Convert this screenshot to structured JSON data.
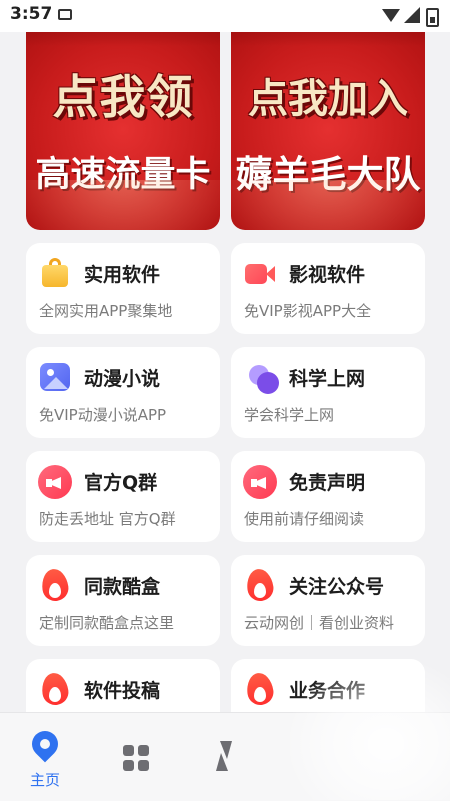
{
  "status_bar": {
    "time": "3:57"
  },
  "banners": [
    {
      "line1": "点我领",
      "line2": "高速流量卡"
    },
    {
      "line1": "点我加入",
      "line2": "薅羊毛大队"
    }
  ],
  "cards": [
    {
      "title": "实用软件",
      "subtitle": "全网实用APP聚集地",
      "icon": "shopping-bag-icon"
    },
    {
      "title": "影视软件",
      "subtitle": "免VIP影视APP大全",
      "icon": "video-camera-icon"
    },
    {
      "title": "动漫小说",
      "subtitle": "免VIP动漫小说APP",
      "icon": "picture-icon"
    },
    {
      "title": "科学上网",
      "subtitle": "学会科学上网",
      "icon": "bubbles-icon"
    },
    {
      "title": "官方Q群",
      "subtitle": "防走丢地址 官方Q群",
      "icon": "megaphone-icon"
    },
    {
      "title": "免责声明",
      "subtitle": "使用前请仔细阅读",
      "icon": "megaphone-icon"
    },
    {
      "title": "同款酷盒",
      "subtitle": "定制同款酷盒点这里",
      "icon": "flame-icon"
    },
    {
      "title": "关注公众号",
      "subtitle": "云动网创｜看创业资料",
      "icon": "flame-icon"
    },
    {
      "title": "软件投稿",
      "subtitle": "",
      "icon": "flame-icon"
    },
    {
      "title": "业务合作",
      "subtitle": "",
      "icon": "flame-icon"
    }
  ],
  "nav": {
    "home_label": "主页"
  },
  "colors": {
    "accent": "#2f72f0",
    "banner_red": "#c81c1c"
  }
}
